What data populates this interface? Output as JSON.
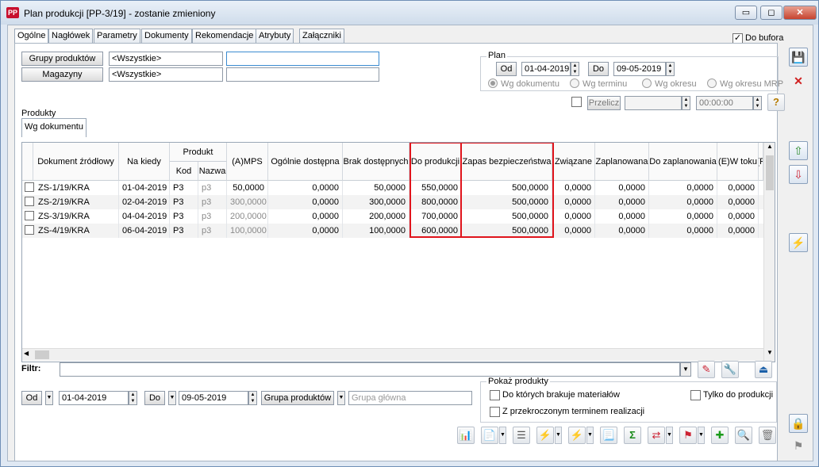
{
  "window": {
    "title": "Plan produkcji [PP-3/19] - zostanie zmieniony",
    "app_icon": "PP",
    "minimize": "▭",
    "maximize": "◻",
    "close": "✕"
  },
  "tabs": [
    "Ogólne",
    "Nagłówek",
    "Parametry",
    "Dokumenty",
    "Rekomendacje",
    "Atrybuty",
    "Załączniki"
  ],
  "do_bufora": {
    "label": "Do bufora",
    "checked": true
  },
  "filters": {
    "grupy_btn": "Grupy produktów",
    "grupy_value": "<Wszystkie>",
    "grupy_extra": "",
    "magazyny_btn": "Magazyny",
    "magazyny_value": "<Wszystkie>",
    "magazyny_extra": ""
  },
  "plan": {
    "label": "Plan",
    "od_btn": "Od",
    "od_value": "01-04-2019",
    "do_btn": "Do",
    "do_value": "09-05-2019",
    "radios": [
      "Wg dokumentu",
      "Wg terminu",
      "Wg okresu",
      "Wg okresu MRP"
    ],
    "selected": 0,
    "przelicz": "Przelicz",
    "przelicz_value": "",
    "time": "00:00:00"
  },
  "produkty": {
    "label": "Produkty",
    "subtab": "Wg dokumentu"
  },
  "grid": {
    "headers": [
      "Dokument źródłowy",
      "Na kiedy",
      "Produkt",
      "Kod",
      "Nazwa",
      "(A)MPS",
      "Ogólnie dostępna",
      "Brak dostępnych",
      "Do produkcji",
      "Zapas bezpieczeństwa",
      "Związane",
      "Zaplanowana",
      "Do zaplanowania",
      "(E)W toku",
      "(F"
    ],
    "rows": [
      {
        "doc": "ZS-1/19/KRA",
        "date": "01-04-2019",
        "kod": "P3",
        "nazwa": "p3",
        "mps": "50,0000",
        "og": "0,0000",
        "brak": "50,0000",
        "dop": "550,0000",
        "zapas": "500,0000",
        "zw": "0,0000",
        "zap": "0,0000",
        "dozap": "0,0000",
        "wtoku": "0,0000"
      },
      {
        "doc": "ZS-2/19/KRA",
        "date": "02-04-2019",
        "kod": "P3",
        "nazwa": "p3",
        "mps": "300,0000",
        "og": "0,0000",
        "brak": "300,0000",
        "dop": "800,0000",
        "zapas": "500,0000",
        "zw": "0,0000",
        "zap": "0,0000",
        "dozap": "0,0000",
        "wtoku": "0,0000"
      },
      {
        "doc": "ZS-3/19/KRA",
        "date": "04-04-2019",
        "kod": "P3",
        "nazwa": "p3",
        "mps": "200,0000",
        "og": "0,0000",
        "brak": "200,0000",
        "dop": "700,0000",
        "zapas": "500,0000",
        "zw": "0,0000",
        "zap": "0,0000",
        "dozap": "0,0000",
        "wtoku": "0,0000"
      },
      {
        "doc": "ZS-4/19/KRA",
        "date": "06-04-2019",
        "kod": "P3",
        "nazwa": "p3",
        "mps": "100,0000",
        "og": "0,0000",
        "brak": "100,0000",
        "dop": "600,0000",
        "zapas": "500,0000",
        "zw": "0,0000",
        "zap": "0,0000",
        "dozap": "0,0000",
        "wtoku": "0,0000"
      }
    ]
  },
  "filtr": {
    "label": "Filtr:",
    "value": ""
  },
  "bottom": {
    "od_btn": "Od",
    "od_value": "01-04-2019",
    "do_btn": "Do",
    "do_value": "09-05-2019",
    "grupa_btn": "Grupa produktów",
    "grupa_placeholder": "Grupa główna"
  },
  "pokaz": {
    "label": "Pokaż produkty",
    "brakuje": "Do których brakuje materiałów",
    "tylko": "Tylko do produkcji",
    "przekroczony": "Z przekroczonym terminem realizacji"
  },
  "icons": {
    "chart": "📊",
    "lightning": "⚡",
    "sigma": "Σ",
    "plus": "✚",
    "search": "🔍",
    "trash": "🗑",
    "save": "💾",
    "cancel": "✕",
    "up": "⇧",
    "down": "⇩",
    "lock": "🔒",
    "help": "?",
    "edit": "✎",
    "wrench": "🔧",
    "filter": "⏏",
    "list": "☰",
    "doc": "📄",
    "arrows": "⇄",
    "page": "📃",
    "mark": "⚑"
  },
  "colors": {
    "highlight": "#e0141c",
    "accent": "#3b8bd0"
  }
}
